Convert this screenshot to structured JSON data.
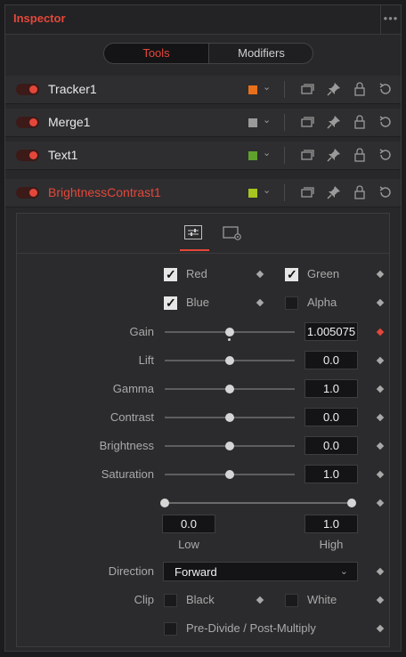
{
  "panel": {
    "title": "Inspector",
    "more": "•••"
  },
  "tabs": [
    {
      "label": "Tools",
      "active": true
    },
    {
      "label": "Modifiers",
      "active": false
    }
  ],
  "tools": [
    {
      "name": "Tracker1",
      "color": "#e8701a",
      "active": false
    },
    {
      "name": "Merge1",
      "color": "#9a9a9a",
      "active": false
    },
    {
      "name": "Text1",
      "color": "#5fa22d",
      "active": false
    },
    {
      "name": "BrightnessContrast1",
      "color": "#a7c61f",
      "active": true
    }
  ],
  "channels": {
    "red": "Red",
    "green": "Green",
    "blue": "Blue",
    "alpha": "Alpha"
  },
  "params": {
    "gain": {
      "label": "Gain",
      "value": "1.005075"
    },
    "lift": {
      "label": "Lift",
      "value": "0.0"
    },
    "gamma": {
      "label": "Gamma",
      "value": "1.0"
    },
    "contrast": {
      "label": "Contrast",
      "value": "0.0"
    },
    "brightness": {
      "label": "Brightness",
      "value": "0.0"
    },
    "saturation": {
      "label": "Saturation",
      "value": "1.0"
    }
  },
  "range": {
    "low_value": "0.0",
    "high_value": "1.0",
    "low_label": "Low",
    "high_label": "High"
  },
  "direction": {
    "label": "Direction",
    "value": "Forward"
  },
  "clip": {
    "label": "Clip",
    "black": "Black",
    "white": "White"
  },
  "predivide": {
    "label": "Pre-Divide / Post-Multiply"
  }
}
